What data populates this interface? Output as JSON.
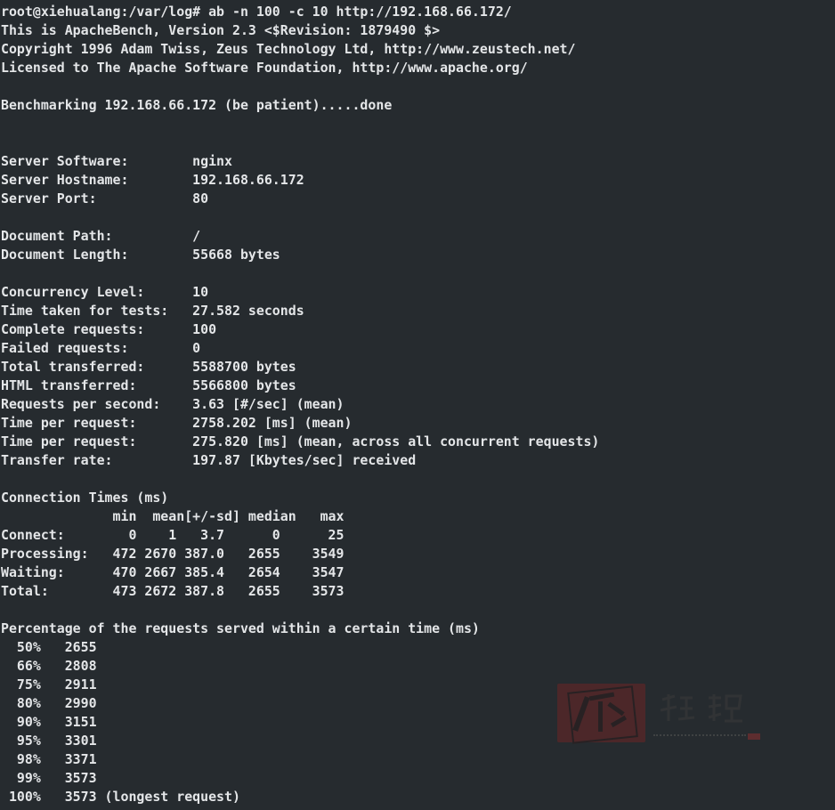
{
  "terminal": {
    "lines": [
      "root@xiehualang:/var/log# ab -n 100 -c 10 http://192.168.66.172/",
      "This is ApacheBench, Version 2.3 <$Revision: 1879490 $>",
      "Copyright 1996 Adam Twiss, Zeus Technology Ltd, http://www.zeustech.net/",
      "Licensed to The Apache Software Foundation, http://www.apache.org/",
      "",
      "Benchmarking 192.168.66.172 (be patient).....done",
      "",
      "",
      "Server Software:        nginx",
      "Server Hostname:        192.168.66.172",
      "Server Port:            80",
      "",
      "Document Path:          /",
      "Document Length:        55668 bytes",
      "",
      "Concurrency Level:      10",
      "Time taken for tests:   27.582 seconds",
      "Complete requests:      100",
      "Failed requests:        0",
      "Total transferred:      5588700 bytes",
      "HTML transferred:       5566800 bytes",
      "Requests per second:    3.63 [#/sec] (mean)",
      "Time per request:       2758.202 [ms] (mean)",
      "Time per request:       275.820 [ms] (mean, across all concurrent requests)",
      "Transfer rate:          197.87 [Kbytes/sec] received",
      "",
      "Connection Times (ms)",
      "              min  mean[+/-sd] median   max",
      "Connect:        0    1   3.7      0      25",
      "Processing:   472 2670 387.0   2655    3549",
      "Waiting:      470 2667 385.4   2654    3547",
      "Total:        473 2672 387.8   2655    3573",
      "",
      "Percentage of the requests served within a certain time (ms)",
      "  50%   2655",
      "  66%   2808",
      "  75%   2911",
      "  80%   2990",
      "  90%   3151",
      "  95%   3301",
      "  98%   3371",
      "  99%   3573",
      " 100%   3573 (longest request)"
    ]
  },
  "colors": {
    "background": "#262b2f",
    "text": "#e4e6e8"
  }
}
